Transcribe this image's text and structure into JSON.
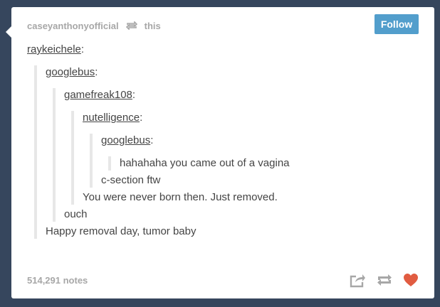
{
  "post": {
    "author": "caseyanthonyofficial",
    "reblog_source": "this",
    "follow_label": "Follow",
    "reblog_chain": {
      "user": "raykeichele",
      "quote": {
        "user": "googlebus",
        "quote": {
          "user": "gamefreak108",
          "quote": {
            "user": "nutelligence",
            "quote": {
              "user": "googlebus",
              "quote": {
                "text": "hahahaha you came out of a vagina"
              },
              "reply": "c-section ftw"
            },
            "reply": "You were never born then. Just removed."
          },
          "reply": "ouch"
        },
        "reply": "Happy removal day, tumor baby"
      }
    },
    "colon": ":",
    "notes": "514,291 notes",
    "icons": {
      "reblog_header": "reblog-icon",
      "share": "share-icon",
      "reblog": "reblog-icon",
      "like": "heart-icon"
    },
    "colors": {
      "background": "#36465d",
      "follow_button": "#529ecc",
      "heart": "#e15c41",
      "muted": "#a7a7a7"
    }
  }
}
